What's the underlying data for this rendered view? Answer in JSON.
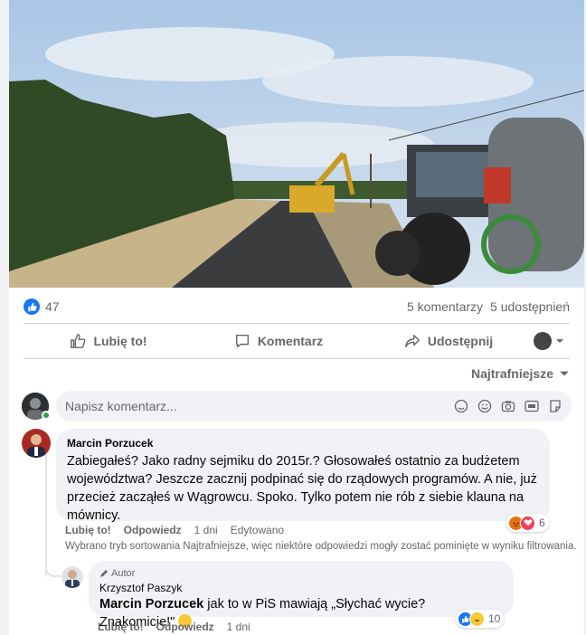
{
  "post": {
    "photo_alt": "",
    "reactions_count": "47",
    "comments_count": "5 komentarzy",
    "shares_count": "5 udostępnień"
  },
  "actions": {
    "like": "Lubię to!",
    "comment": "Komentarz",
    "share": "Udostępnij"
  },
  "sort": {
    "label": "Najtrafniejsze"
  },
  "composer": {
    "placeholder": "Napisz komentarz..."
  },
  "comments": [
    {
      "author": "Marcin Porzucek",
      "text": "Zabiegałeś? Jako radny sejmiku do 2015r.? Głosowałeś ostatnio za budżetem województwa? Jeszcze zacznij podpinać się do rządowych programów. A nie, już przecież zacząłeś w Wągrowcu. Spoko. Tylko potem nie rób z siebie klauna na mównicy.",
      "like": "Lubię to!",
      "reply": "Odpowiedz",
      "time": "1 dni",
      "edited": "Edytowano",
      "reactions": "6"
    }
  ],
  "filter_note": "Wybrano tryb sortowania Najtrafniejsze, więc niektóre odpowiedzi mogły zostać pominięte w wyniku filtrowania.",
  "reply": {
    "tag": "Autor",
    "author": "Krzysztof Paszyk",
    "mention": "Marcin Porzucek",
    "text": " jak to w PiS mawiają „Słychać wycie? Znakomicie!\"",
    "like": "Lubię to!",
    "reply": "Odpowiedz",
    "time": "1 dni",
    "reactions": "10"
  },
  "colors": {
    "accent": "#1877f2",
    "muted": "#65676b",
    "bubble": "#f0f2f5"
  }
}
